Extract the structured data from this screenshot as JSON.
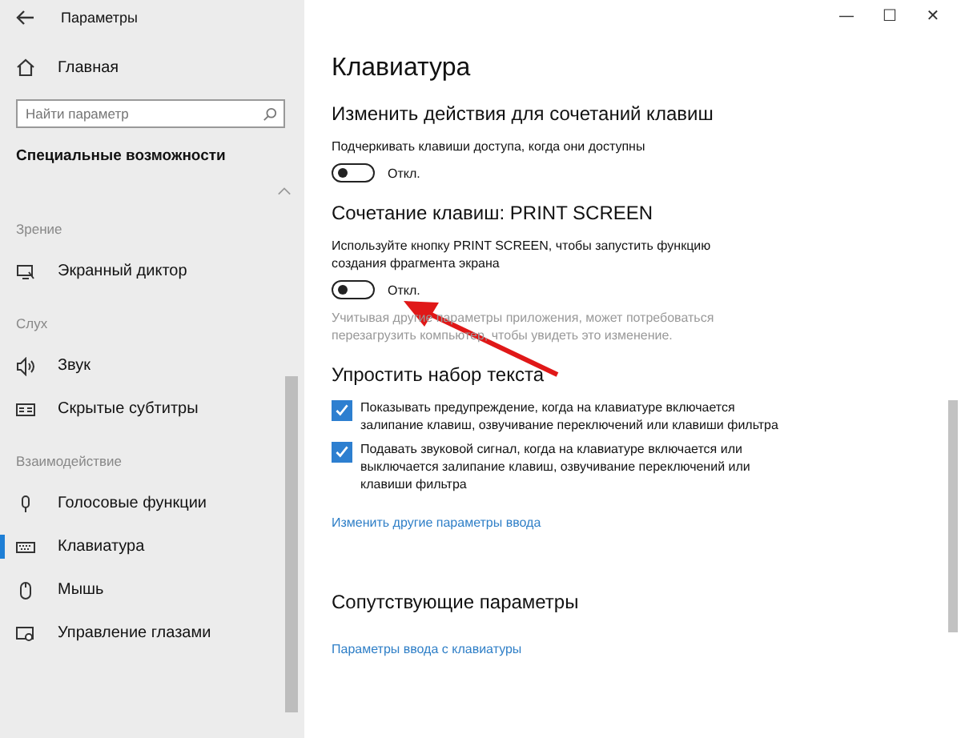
{
  "window": {
    "title": "Параметры",
    "controls": [
      "—",
      "☐",
      "✕"
    ]
  },
  "sidebar": {
    "home": "Главная",
    "search": {
      "placeholder": "Найти параметр"
    },
    "category": "Специальные возможности",
    "groups": [
      {
        "title": "Зрение",
        "items": [
          {
            "label": "Экранный диктор",
            "selected": false
          }
        ]
      },
      {
        "title": "Слух",
        "items": [
          {
            "label": "Звук",
            "selected": false
          },
          {
            "label": "Скрытые субтитры",
            "selected": false
          }
        ]
      },
      {
        "title": "Взаимодействие",
        "items": [
          {
            "label": "Голосовые функции",
            "selected": false
          },
          {
            "label": "Клавиатура",
            "selected": true
          },
          {
            "label": "Мышь",
            "selected": false
          },
          {
            "label": "Управление глазами",
            "selected": false
          }
        ]
      }
    ]
  },
  "page": {
    "title": "Клавиатура",
    "sections": [
      {
        "heading": "Изменить действия для сочетаний клавиш",
        "items": [
          {
            "kind": "toggle",
            "label": "Подчеркивать клавиши доступа, когда они доступны",
            "on": false,
            "state": "Откл."
          }
        ]
      },
      {
        "heading": "Сочетание клавиш: PRINT SCREEN",
        "items": [
          {
            "kind": "toggle",
            "label": "Используйте кнопку PRINT SCREEN, чтобы запустить функцию создания фрагмента экрана",
            "on": false,
            "state": "Откл."
          },
          {
            "kind": "note",
            "text": "Учитывая другие параметры приложения, может потребоваться перезагрузить компьютер, чтобы увидеть это изменение."
          }
        ]
      },
      {
        "heading": "Упростить набор текста",
        "items": [
          {
            "kind": "checkbox",
            "label": "Показывать предупреждение, когда на клавиатуре включается залипание клавиш, озвучивание переключений или клавиши фильтра",
            "checked": true
          },
          {
            "kind": "checkbox",
            "label": "Подавать звуковой сигнал, когда на клавиатуре включается или выключается залипание клавиш, озвучивание переключений или клавиши фильтра",
            "checked": true
          },
          {
            "kind": "link",
            "text": "Изменить другие параметры ввода"
          }
        ]
      },
      {
        "heading": "Сопутствующие параметры",
        "items": [
          {
            "kind": "link",
            "text": "Параметры ввода с клавиатуры"
          }
        ]
      }
    ]
  }
}
